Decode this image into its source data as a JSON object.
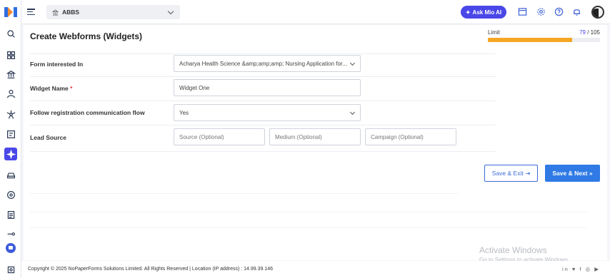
{
  "topbar": {
    "institute": "ABBS",
    "ask_mio": "Ask Mio AI"
  },
  "page": {
    "title": "Create Webforms (Widgets)"
  },
  "limit": {
    "label": "Limit",
    "used": "79",
    "separator": " / ",
    "total": "105",
    "fraction": 0.752
  },
  "form": {
    "form_interested_label": "Form interested In",
    "form_interested_value": "Acharya Health Science &amp;amp;amp; Nursing Application for...",
    "widget_name_label": "Widget Name",
    "widget_name_required": "*",
    "widget_name_value": "Widget One",
    "follow_flow_label": "Follow registration communication flow",
    "follow_flow_value": "Yes",
    "lead_source_label": "Lead Source",
    "source_placeholder": "Source (Optional)",
    "medium_placeholder": "Medium (Optional)",
    "campaign_placeholder": "Campaign (Optional)"
  },
  "actions": {
    "save_exit": "Save & Exit",
    "save_exit_icon": "⇥",
    "save_next": "Save & Next",
    "save_next_icon": "»"
  },
  "footer": {
    "copyright": "Copyright © 2025 NoPaperForms Solutions Limited. All Rights Reserved | Location (IP address) : 14.99.39.146",
    "social": "in ♥ f ◎ ▶"
  },
  "watermark": {
    "line1": "Activate Windows",
    "line2": "Go to Settings to activate Windows."
  },
  "colors": {
    "accent": "#4a47e8",
    "primary_button": "#2f7ae5",
    "limit_fill": "#f5a623"
  }
}
